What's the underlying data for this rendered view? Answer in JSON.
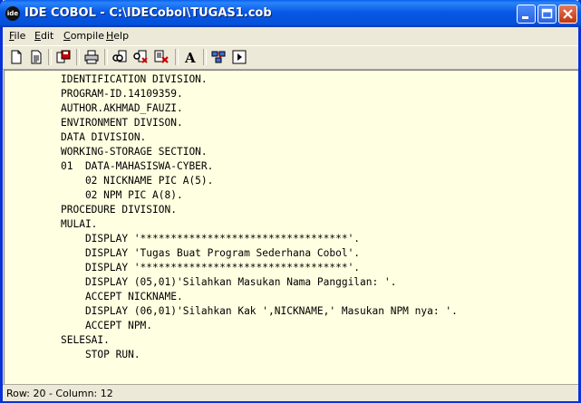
{
  "window": {
    "title": "IDE COBOL - C:\\IDECobol\\TUGAS1.cob",
    "app_icon_text": "ide"
  },
  "title_buttons": [
    "minimize-icon",
    "maximize-icon",
    "close-icon"
  ],
  "menu": {
    "items": [
      {
        "mnemonic": "F",
        "rest": "ile"
      },
      {
        "mnemonic": "E",
        "rest": "dit"
      },
      {
        "mnemonic": "C",
        "rest": "ompile"
      },
      {
        "mnemonic": "H",
        "rest": "elp"
      }
    ]
  },
  "toolbar": {
    "tools": [
      "new-file-icon",
      "open-file-icon",
      "save-icon",
      "print-icon",
      "find-icon",
      "find-next-icon",
      "replace-icon",
      "font-icon",
      "compile-icon",
      "run-icon"
    ],
    "font_glyph": "A"
  },
  "editor": {
    "lines": [
      "IDENTIFICATION DIVISION.",
      "PROGRAM-ID.14109359.",
      "AUTHOR.AKHMAD_FAUZI.",
      "ENVIRONMENT DIVISON.",
      "DATA DIVISION.",
      "WORKING-STORAGE SECTION.",
      "01  DATA-MAHASISWA-CYBER.",
      "    02 NICKNAME PIC A(5).",
      "    02 NPM PIC A(8).",
      "PROCEDURE DIVISION.",
      "MULAI.",
      "    DISPLAY '**********************************'.",
      "    DISPLAY 'Tugas Buat Program Sederhana Cobol'.",
      "    DISPLAY '**********************************'.",
      "    DISPLAY (05,01)'Silahkan Masukan Nama Panggilan: '.",
      "    ACCEPT NICKNAME.",
      "    DISPLAY (06,01)'Silahkan Kak ',NICKNAME,' Masukan NPM nya: '.",
      "    ACCEPT NPM.",
      "SELESAI.",
      "    STOP RUN."
    ]
  },
  "status": {
    "text": "Row: 20 - Column: 12"
  }
}
